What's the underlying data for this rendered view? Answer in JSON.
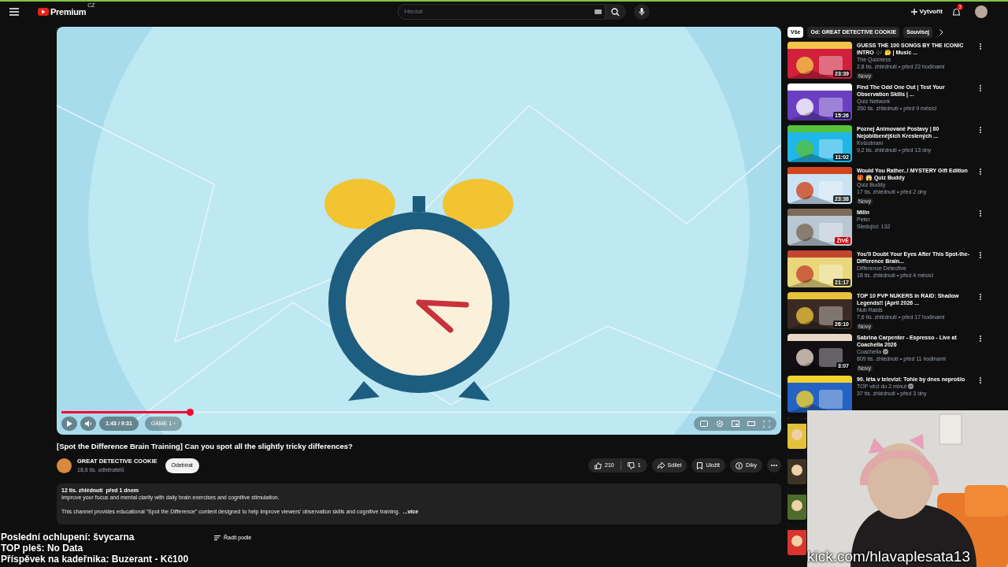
{
  "topbar": {
    "logo": "Premium",
    "region": "CZ",
    "search": {
      "placeholder": "Hledat"
    },
    "create": "Vytvořit",
    "notifications": "3"
  },
  "player": {
    "time": "1:43 / 9:31",
    "chapter": "GAME 1 ›",
    "progress": {
      "level": 0.18
    }
  },
  "video": {
    "title": "[Spot the Difference Brain Training] Can you spot all the slightly tricky differences?",
    "channel": "GREAT DETECTIVE COOKIE",
    "subscribers": "18,6 tis. odběratelů",
    "subscribe": "Odebírat",
    "likes": "210",
    "dislikes": "1",
    "actions": [
      "Sdílet",
      "Uložit",
      "Díky"
    ]
  },
  "description": {
    "meta": "12 tis. zhlédnutí  před 1 dnem",
    "line1": "Improve your focus and mental clarity with daily brain exercises and cognitive stimulation.",
    "line2": "This channel provides educational “Spot the Difference” content designed to help improve viewers’ observation skills and cognitive training.",
    "more": "...více"
  },
  "comments": {
    "sort": "Řadit podle"
  },
  "chips": [
    {
      "label": "Vše",
      "selected": true
    },
    {
      "label": "Od: GREAT DETECTIVE COOKIE",
      "selected": false
    },
    {
      "label": "Souvisej",
      "selected": false
    }
  ],
  "recommendations": [
    {
      "title": "GUESS THE 100 SONGS BY THE ICONIC INTRO 🎶 🤔 | Music ...",
      "channel": "The Quizness",
      "meta": "2,8 tis. zhlédnutí • před 22 hodinami",
      "badge": "Nový",
      "duration": "23:39"
    },
    {
      "title": "Find The Odd One Out | Test Your Observation Skills | ...",
      "channel": "Quiz Network",
      "meta": "350 tis. zhlédnutí • před 9 měsíci",
      "duration": "15:26"
    },
    {
      "title": "Poznej Animované Postavy | 80 Nejoblíbenějších Kreslených ...",
      "channel": "Kvízobraní",
      "meta": "9,2 tis. zhlédnutí • před 13 dny",
      "duration": "11:02"
    },
    {
      "title": "Would You Rather..! MYSTERY Gift Edition 🎁 😱 Quiz Buddy",
      "channel": "Quiz Buddy",
      "meta": "17 tis. zhlédnutí • před 2 dny",
      "badge": "Nový",
      "duration": "23:38"
    },
    {
      "title": "Milin",
      "channel": "Peter",
      "meta": "Sledující: 132",
      "live": "ŽIVĚ"
    },
    {
      "title": "You'll Doubt Your Eyes After This Spot-the-Difference Brain...",
      "channel": "Difference Detective",
      "meta": "18 tis. zhlédnutí • před 4 měsíci",
      "duration": "21:17"
    },
    {
      "title": "TOP 10 PVP NUKERS in RAID: Shadow Legends!! (April 2026 ...",
      "channel": "Nub Raids",
      "meta": "7,6 tis. zhlédnutí • před 17 hodinami",
      "badge": "Nový",
      "duration": "26:10"
    },
    {
      "title": "Sabrina Carpenter - Espresso - Live at Coachella 2026",
      "channel": "Coachella",
      "verified": true,
      "meta": "809 tis. zhlédnutí • před 11 hodinami",
      "badge": "Nový",
      "duration": "3:07"
    },
    {
      "title": "90. léta v televizi: Tohle by dnes neprošlo",
      "channel": "TOP věci do 2 minut",
      "verified": true,
      "meta": "37 tis. zhlédnutí • před 3 dny"
    }
  ],
  "overlay": {
    "lines": [
      "Poslední ochlupení: švycarna",
      "TOP pleš: No Data",
      "Příspěvek na kadeřnika: Buzerant - Kč100"
    ],
    "webcam_caption": "kick.com/hlavaplesata13"
  }
}
